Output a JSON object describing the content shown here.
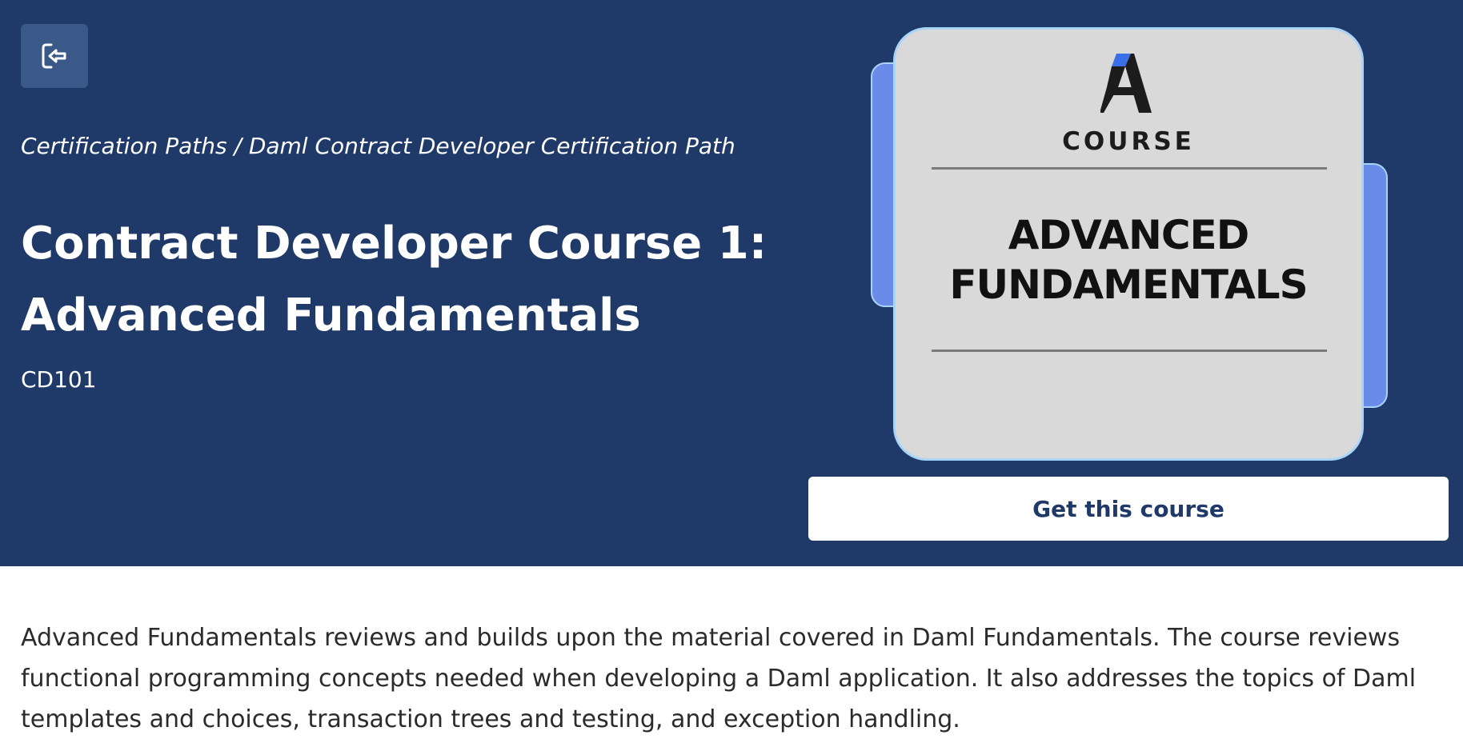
{
  "header": {
    "exit_icon": "exit-icon",
    "breadcrumb": "Certification Paths / Daml Contract Developer Certification Path",
    "title_line1": "Contract Developer Course 1:",
    "title_line2": "Advanced Fundamentals",
    "course_code": "CD101"
  },
  "course_card": {
    "logo_icon": "a-logo-icon",
    "label": "COURSE",
    "heading_line1": "ADVANCED",
    "heading_line2": "FUNDAMENTALS"
  },
  "cta": {
    "label": "Get this course"
  },
  "description": "Advanced Fundamentals reviews and builds upon the material covered in Daml Fundamentals. The course reviews functional programming concepts needed when developing a Daml application. It also addresses the topics of Daml templates and choices, transaction trees and testing, and exception handling.",
  "colors": {
    "hero_background": "#1f3a68",
    "button_background": "#ffffff",
    "button_text": "#1f3a68",
    "card_background": "#d9d9d9",
    "card_tab": "#6a8ce8",
    "logo_accent": "#3b6fe8"
  }
}
